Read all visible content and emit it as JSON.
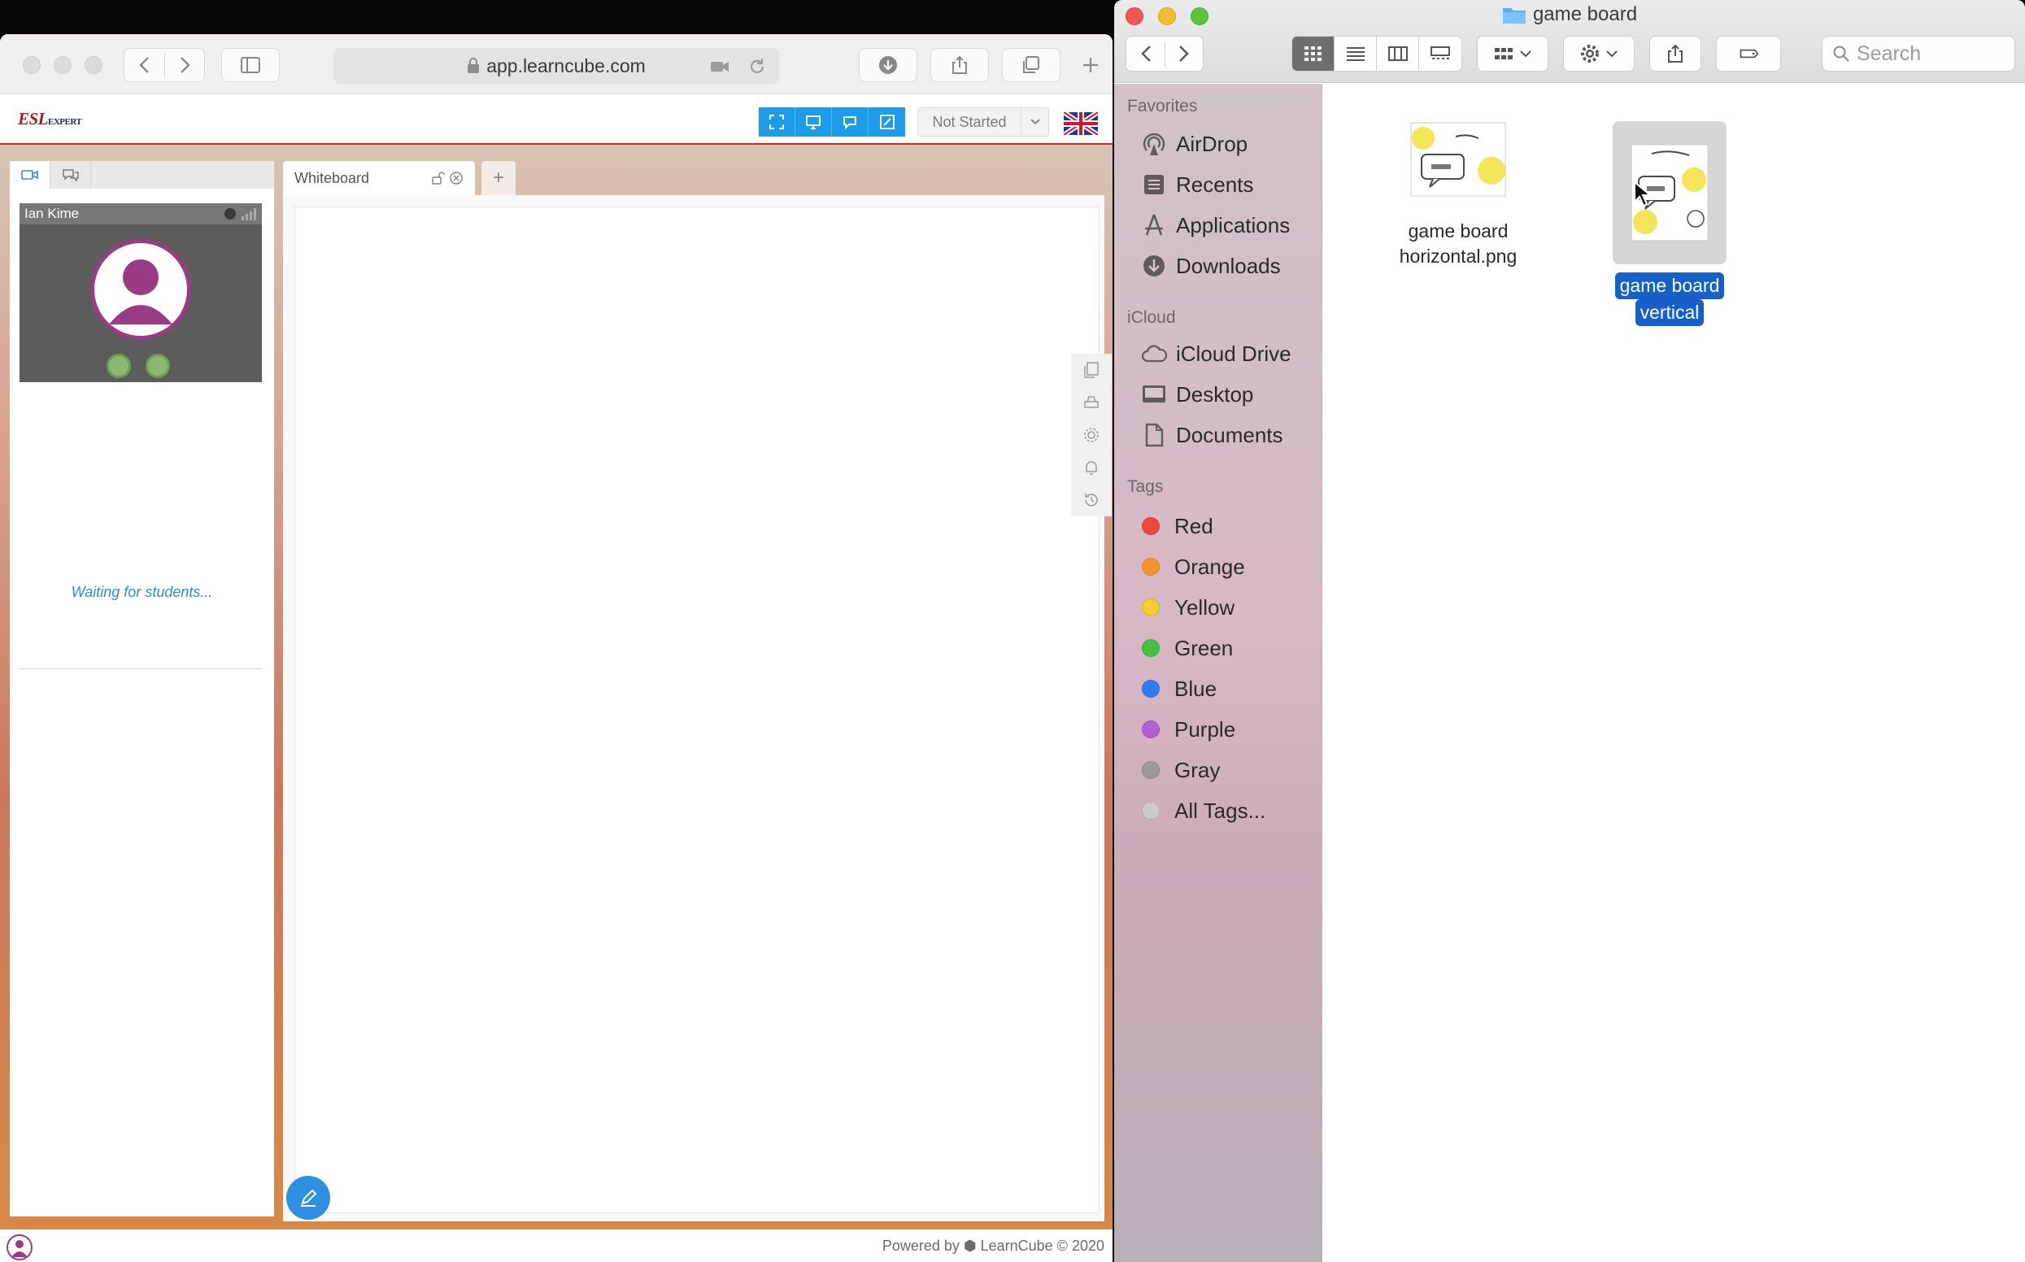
{
  "safari": {
    "url": "app.learncube.com"
  },
  "app": {
    "brand": "ESL",
    "brand_sub": "EXPERT",
    "status_select": "Not Started",
    "participant_name": "Ian Kime",
    "waiting_text": "Waiting for students...",
    "whiteboard_tab": "Whiteboard",
    "add_tab": "+",
    "footer": "Powered by ⬢ LearnCube © 2020"
  },
  "finder": {
    "title": "game board",
    "search_placeholder": "Search",
    "favorites_header": "Favorites",
    "favorites": [
      "AirDrop",
      "Recents",
      "Applications",
      "Downloads"
    ],
    "icloud_header": "iCloud",
    "icloud": [
      "iCloud Drive",
      "Desktop",
      "Documents"
    ],
    "tags_header": "Tags",
    "tags": [
      {
        "label": "Red",
        "color": "#f0463d"
      },
      {
        "label": "Orange",
        "color": "#f4952c"
      },
      {
        "label": "Yellow",
        "color": "#f5cc32"
      },
      {
        "label": "Green",
        "color": "#46c043"
      },
      {
        "label": "Blue",
        "color": "#2f7bf0"
      },
      {
        "label": "Purple",
        "color": "#b15fd6"
      },
      {
        "label": "Gray",
        "color": "#9a9a9a"
      },
      {
        "label": "All Tags...",
        "color": "#d0c8cc"
      }
    ],
    "files": [
      {
        "line1": "game board",
        "line2": "horizontal.png",
        "selected": false
      },
      {
        "line1": "game board",
        "line2": "vertical",
        "selected": true
      }
    ]
  },
  "colors": {
    "accent_blue": "#1d9ce8",
    "finder_selection": "#1560c9",
    "brand_red": "#b3151c"
  }
}
